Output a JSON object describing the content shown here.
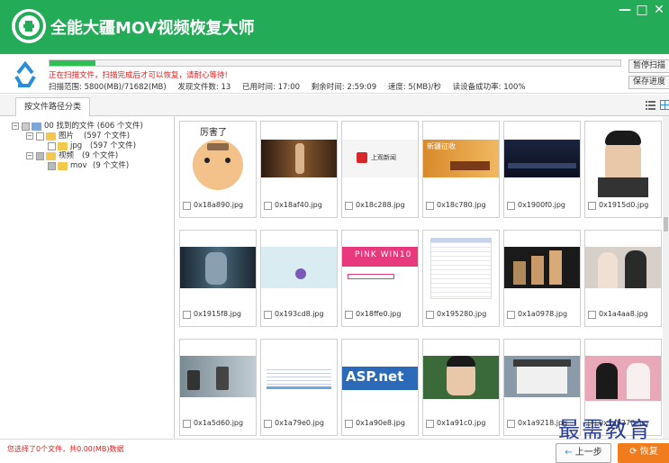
{
  "app": {
    "title": "全能大疆MOV视频恢复大师"
  },
  "window_controls": {
    "minimize": "—",
    "maximize": "□",
    "close": "✕"
  },
  "status": {
    "progress": 0.08,
    "message": "正在扫描文件，扫描完成后才可以恢复，请耐心等待!",
    "scan_range": "扫描范围: 5800(MB)/71682(MB)",
    "found_files": "发现文件数: 13",
    "elapsed": "已用时间: 17:00",
    "remaining": "剩余时间: 2:59:09",
    "speed": "速度: 5(MB)/秒",
    "read_success": "读设备成功率: 100%",
    "pause_label": "暂停扫描",
    "save_label": "保存进度"
  },
  "tabs": [
    {
      "label": "按文件路径分类"
    }
  ],
  "tree": {
    "root": "00 找到的文件 (606 个文件)",
    "pictures": "图片",
    "pictures_count": "(597 个文件)",
    "jpg": "jpg",
    "jpg_count": "(597 个文件)",
    "videos": "视频",
    "videos_count": "(9 个文件)",
    "mov": "mov",
    "mov_count": "(9 个文件)"
  },
  "thumbnails": [
    {
      "name": "0x18a890.jpg",
      "text": "厉害了"
    },
    {
      "name": "0x18af40.jpg"
    },
    {
      "name": "0x18c288.jpg",
      "text": "上观新闻"
    },
    {
      "name": "0x18c780.jpg",
      "text": "新疆征收"
    },
    {
      "name": "0x1900f0.jpg"
    },
    {
      "name": "0x1915d0.jpg"
    },
    {
      "name": "0x1915f8.jpg"
    },
    {
      "name": "0x193cd8.jpg"
    },
    {
      "name": "0x18ffe0.jpg",
      "text": "PINK WIN10"
    },
    {
      "name": "0x195280.jpg"
    },
    {
      "name": "0x1a0978.jpg"
    },
    {
      "name": "0x1a4aa8.jpg"
    },
    {
      "name": "0x1a5d60.jpg"
    },
    {
      "name": "0x1a79e0.jpg"
    },
    {
      "name": "0x1a90e8.jpg",
      "text": "ASP.net"
    },
    {
      "name": "0x1a91c0.jpg"
    },
    {
      "name": "0x1a9218.jpg"
    },
    {
      "name": "0x1a9270.jpg"
    }
  ],
  "footer": {
    "selected_msg": "您选择了0个文件，共0.00(MB)数据",
    "prev_label": "上一步",
    "recover_label": "恢复"
  },
  "watermark": "最需教育",
  "colors": {
    "title_green": "#23ab58",
    "progress_green": "#2fbf55",
    "recover_orange": "#f07c1c",
    "alert_red": "#e02020"
  }
}
